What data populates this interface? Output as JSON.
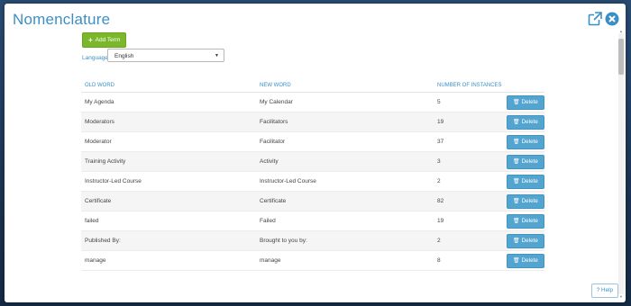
{
  "modal": {
    "title": "Nomenclature"
  },
  "toolbar": {
    "add_plus": "+",
    "add_label": "Add Term"
  },
  "language": {
    "label": "Language",
    "selected": "English",
    "caret": "▼"
  },
  "table": {
    "headers": {
      "old": "OLD WORD",
      "new": "NEW WORD",
      "count": "NUMBER OF INSTANCES"
    },
    "delete_label": "Delete",
    "rows": [
      {
        "old": "My Agenda",
        "new": "My Calendar",
        "count": "5"
      },
      {
        "old": "Moderators",
        "new": "Facilitators",
        "count": "19"
      },
      {
        "old": "Moderator",
        "new": "Facilitator",
        "count": "37"
      },
      {
        "old": "Training Activity",
        "new": "Activity",
        "count": "3"
      },
      {
        "old": "Instructor-Led Course",
        "new": "Instructor-Led Course",
        "count": "2"
      },
      {
        "old": "Certificate",
        "new": "Certificate",
        "count": "82"
      },
      {
        "old": "failed",
        "new": "Failed",
        "count": "19"
      },
      {
        "old": "Published By:",
        "new": "Brought to you by:",
        "count": "2"
      },
      {
        "old": "manage",
        "new": "manage",
        "count": "8"
      }
    ]
  },
  "help": {
    "icon": "?",
    "label": "Help"
  },
  "colors": {
    "accent": "#3c8fc6",
    "add_button": "#7ab72a",
    "delete_button": "#53a4cf"
  }
}
